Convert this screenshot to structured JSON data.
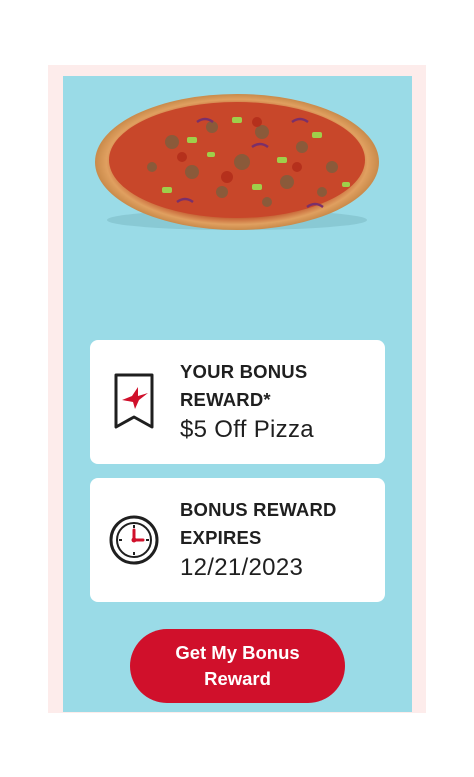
{
  "colors": {
    "panel_bg": "#9adbe7",
    "frame_bg": "#fdeceb",
    "accent_red": "#d0102b",
    "text_dark": "#1f1f1f",
    "card_bg": "#ffffff"
  },
  "hero": {
    "image": "pizza-image"
  },
  "reward_card": {
    "icon": "bookmark-bird-icon",
    "title": "YOUR BONUS REWARD*",
    "value": "$5 Off Pizza"
  },
  "expires_card": {
    "icon": "clock-icon",
    "title": "BONUS REWARD EXPIRES",
    "value": "12/21/2023"
  },
  "cta": {
    "label": "Get My Bonus Reward"
  }
}
